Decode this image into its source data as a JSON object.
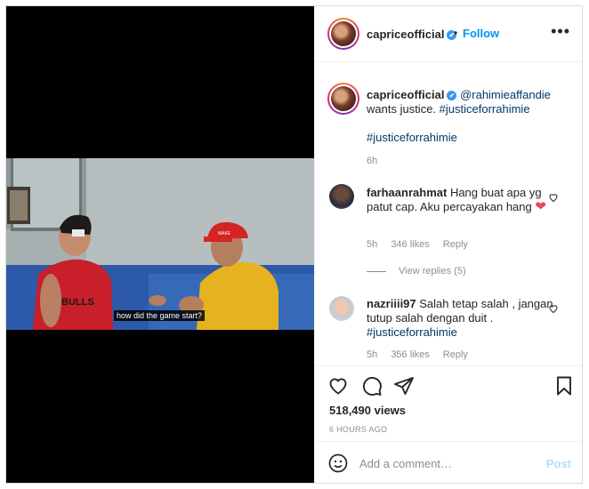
{
  "header": {
    "username": "capriceofficial",
    "verified_mark": "✔",
    "separator": "•",
    "follow_label": "Follow",
    "more_icon": "•••"
  },
  "video": {
    "subtitle": "how did the game start?"
  },
  "caption": {
    "username": "capriceofficial",
    "mention": "@rahimieaffandie",
    "text": "wants justice.",
    "hashtag1": "#justiceforrahimie",
    "hashtag2": "#justiceforrahimie",
    "time": "6h"
  },
  "comments": [
    {
      "username": "farhaanrahmat",
      "text": "Hang buat apa yg patut cap. Aku percayakan hang",
      "emoji": "❤",
      "time": "5h",
      "likes": "346 likes",
      "reply": "Reply",
      "view_replies": "View replies (5)"
    },
    {
      "username": "nazriiii97",
      "text": "Salah tetap salah , jangan tutup salah dengan duit .",
      "hashtag": "#justiceforrahimie",
      "time": "5h",
      "likes": "356 likes",
      "reply": "Reply"
    }
  ],
  "stats": {
    "views": "518,490 views",
    "ago": "6 HOURS AGO"
  },
  "add_comment": {
    "placeholder": "Add a comment…",
    "post_label": "Post"
  },
  "colors": {
    "accent": "#0095f6",
    "post_disabled": "#b2dffc",
    "muted": "#8e8e8e",
    "heart_red": "#ed4956",
    "link": "#00376b"
  }
}
